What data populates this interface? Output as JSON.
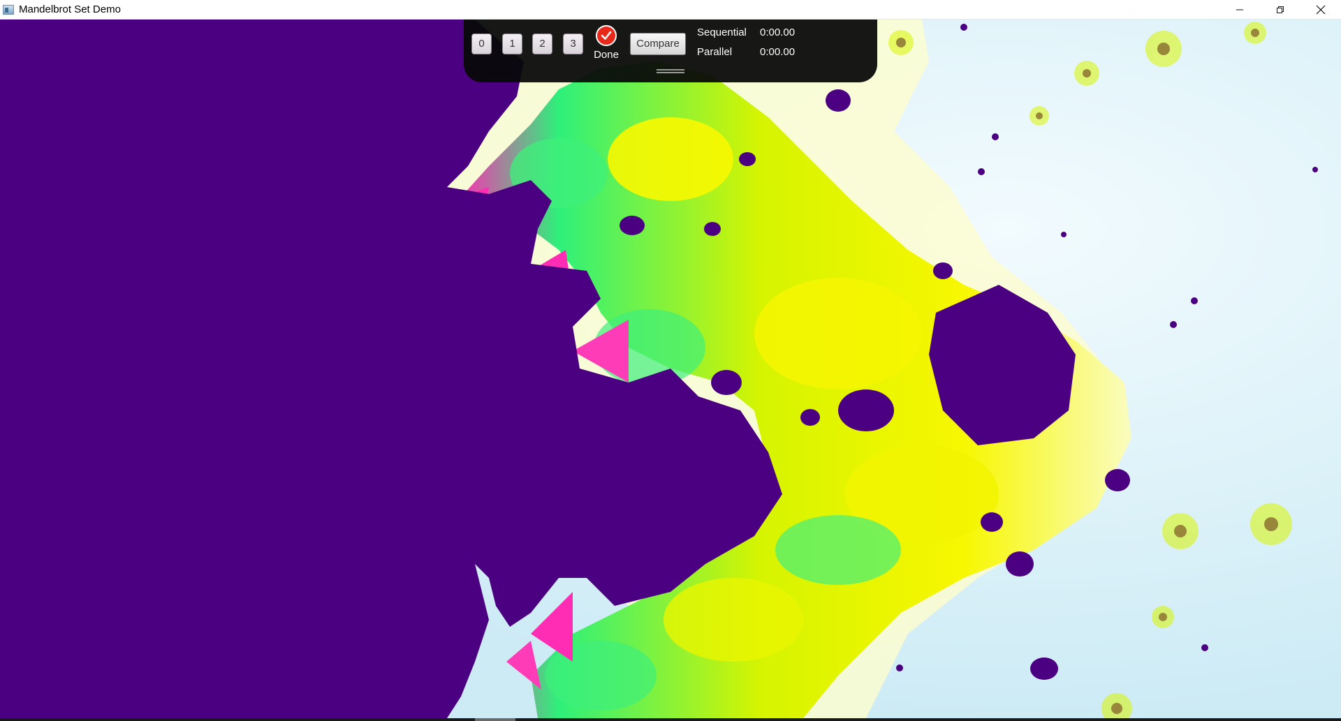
{
  "window": {
    "title": "Mandelbrot Set Demo",
    "caption": {
      "minimize_icon": "minimize-icon",
      "maximize_icon": "restore-icon",
      "close_icon": "close-icon"
    }
  },
  "toolbar": {
    "buttons": [
      "0",
      "1",
      "2",
      "3"
    ],
    "status_label": "Done",
    "status_icon": "checkmark-icon",
    "compare_label": "Compare",
    "stats": [
      {
        "label": "Sequential",
        "value": "0:00.00"
      },
      {
        "label": "Parallel",
        "value": "0:00.00"
      }
    ],
    "grip_icon": "drag-handle-icon"
  },
  "colors": {
    "set_interior": "#4b0082",
    "far_field": "#dff4fb",
    "band_yellow": "#f5f500",
    "band_green": "#2ef07a",
    "band_magenta": "#ff2db4",
    "status_red": "#e8291a"
  }
}
